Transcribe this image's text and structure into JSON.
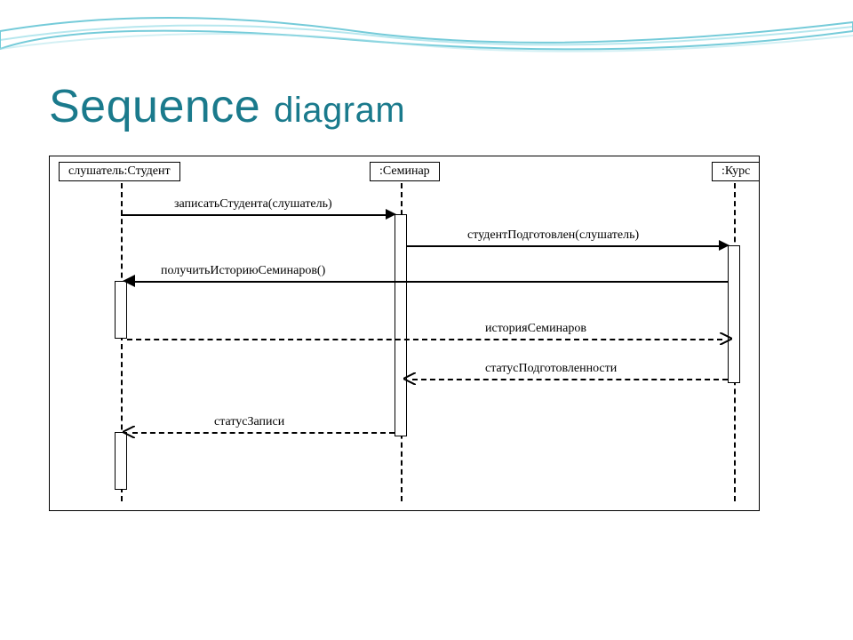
{
  "title_word1": "Sequence",
  "title_word2": "diagram",
  "participants": {
    "student": "слушатель:Студент",
    "seminar": ":Семинар",
    "course": ":Курс"
  },
  "messages": {
    "m1": "записатьСтудента(слушатель)",
    "m2": "студентПодготовлен(слушатель)",
    "m3": "получитьИсториюСеминаров()",
    "m4": "историяСеминаров",
    "m5": "статусПодготовленности",
    "m6": "статусЗаписи"
  },
  "colors": {
    "title": "#1a7a8c",
    "wave": "#3bb5c9"
  }
}
